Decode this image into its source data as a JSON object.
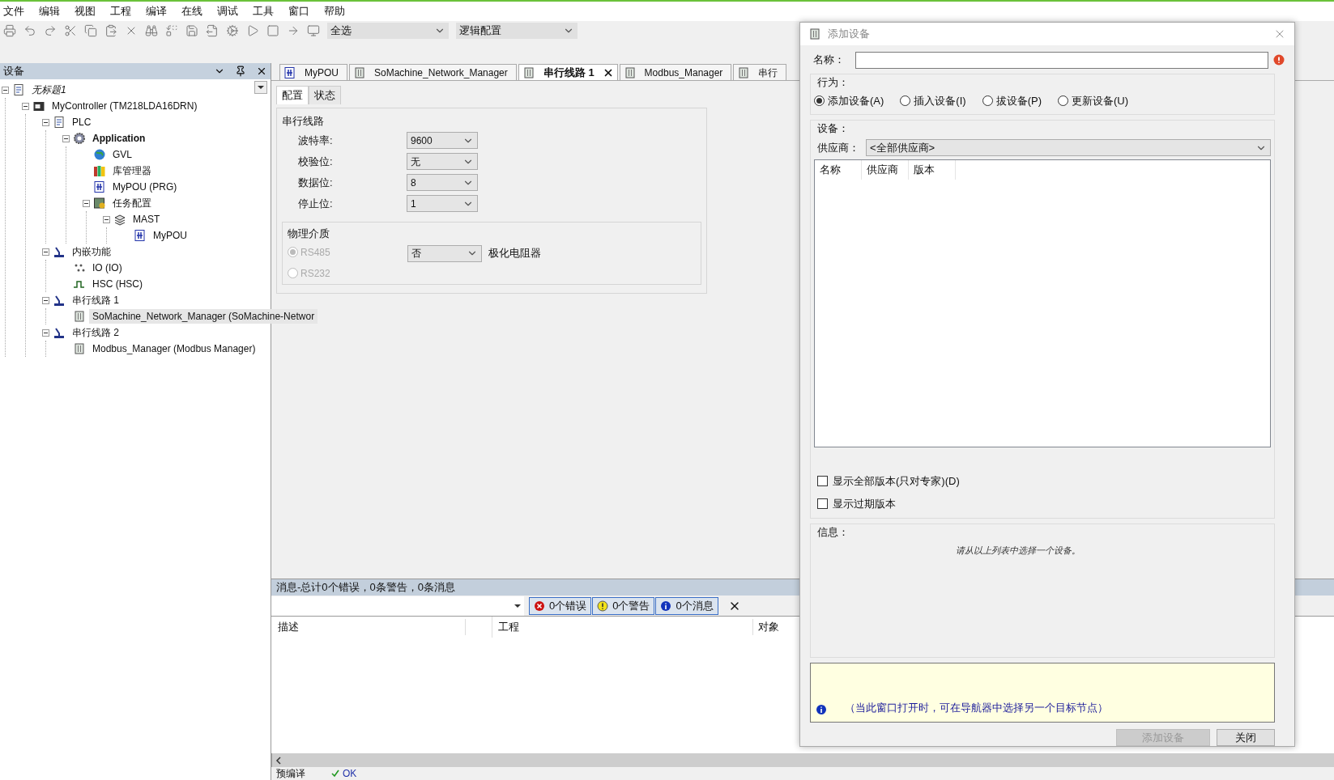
{
  "menu": [
    "文件",
    "编辑",
    "视图",
    "工程",
    "编译",
    "在线",
    "调试",
    "工具",
    "窗口",
    "帮助"
  ],
  "toolbar": {
    "selection": "全选",
    "configuration": "逻辑配置"
  },
  "devices_panel": {
    "title": "设备",
    "tree": [
      {
        "kind": "project",
        "label": "无标题1",
        "expanded": true,
        "selected": false,
        "children": [
          {
            "kind": "controller",
            "label": "MyController (TM218LDA16DRN)",
            "expanded": true,
            "selected": false,
            "children": [
              {
                "kind": "plc",
                "label": "PLC",
                "expanded": true,
                "selected": false,
                "children": [
                  {
                    "kind": "application",
                    "label": "Application",
                    "expanded": true,
                    "selected": false,
                    "children": [
                      {
                        "kind": "gvl",
                        "label": "GVL",
                        "selected": false
                      },
                      {
                        "kind": "library",
                        "label": "库管理器",
                        "selected": false
                      },
                      {
                        "kind": "pou",
                        "label": "MyPOU (PRG)",
                        "selected": false
                      },
                      {
                        "kind": "task_config",
                        "label": "任务配置",
                        "expanded": true,
                        "selected": false,
                        "children": [
                          {
                            "kind": "task",
                            "label": "MAST",
                            "expanded": true,
                            "selected": false,
                            "children": [
                              {
                                "kind": "pou_call",
                                "label": "MyPOU",
                                "selected": false
                              }
                            ]
                          }
                        ]
                      }
                    ]
                  }
                ]
              },
              {
                "kind": "folder",
                "label": "内嵌功能",
                "expanded": true,
                "selected": false,
                "children": [
                  {
                    "kind": "io",
                    "label": "IO (IO)",
                    "selected": false
                  },
                  {
                    "kind": "hsc",
                    "label": "HSC (HSC)",
                    "selected": false
                  }
                ]
              },
              {
                "kind": "folder",
                "label": "串行线路 1",
                "expanded": true,
                "selected": false,
                "children": [
                  {
                    "kind": "manager",
                    "label": "SoMachine_Network_Manager (SoMachine-Networ",
                    "selected": true
                  }
                ]
              },
              {
                "kind": "folder",
                "label": "串行线路 2",
                "expanded": true,
                "selected": false,
                "children": [
                  {
                    "kind": "manager",
                    "label": "Modbus_Manager (Modbus Manager)",
                    "selected": false
                  }
                ]
              }
            ]
          }
        ]
      }
    ]
  },
  "editor_tabs": [
    {
      "kind": "pou",
      "label": "MyPOU",
      "selected": false
    },
    {
      "kind": "manager",
      "label": "SoMachine_Network_Manager",
      "selected": false
    },
    {
      "kind": "manager",
      "label": "串行线路 1",
      "selected": true
    },
    {
      "kind": "manager",
      "label": "Modbus_Manager",
      "selected": false
    },
    {
      "kind": "manager",
      "label": "串行",
      "selected": false
    }
  ],
  "sub_tabs": [
    {
      "label": "配置",
      "selected": true
    },
    {
      "label": "状态",
      "selected": false
    }
  ],
  "serial_line": {
    "title": "串行线路",
    "fields": [
      {
        "label": "波特率:",
        "value": "9600"
      },
      {
        "label": "校验位:",
        "value": "无"
      },
      {
        "label": "数据位:",
        "value": "8"
      },
      {
        "label": "停止位:",
        "value": "1"
      }
    ]
  },
  "physical_medium": {
    "title": "物理介质",
    "options": [
      {
        "label": "RS485",
        "selected": true,
        "disabled": true
      },
      {
        "label": "RS232",
        "selected": false,
        "disabled": true
      }
    ],
    "polarization": {
      "value": "否",
      "label": "极化电阻器"
    }
  },
  "messages": {
    "title": "消息-总计0个错误，0条警告，0条消息",
    "filters": [
      {
        "kind": "error",
        "label": "0个错误"
      },
      {
        "kind": "warning",
        "label": "0个警告"
      },
      {
        "kind": "info",
        "label": "0个消息"
      }
    ],
    "columns": [
      "描述",
      "工程",
      "对象"
    ]
  },
  "status_bar": {
    "label": "预编译",
    "value": "OK"
  },
  "dialog": {
    "title": "添加设备",
    "name_label": "名称：",
    "behavior": {
      "title": "行为：",
      "options": [
        {
          "label": "添加设备(A)",
          "selected": true
        },
        {
          "label": "插入设备(I)",
          "selected": false
        },
        {
          "label": "拔设备(P)",
          "selected": false
        },
        {
          "label": "更新设备(U)",
          "selected": false
        }
      ]
    },
    "device": {
      "title": "设备：",
      "vendor_label": "供应商：",
      "vendor_value": "<全部供应商>",
      "columns": [
        "名称",
        "供应商",
        "版本"
      ]
    },
    "checkboxes": [
      {
        "label": "显示全部版本(只对专家)(D)",
        "checked": false
      },
      {
        "label": "显示过期版本",
        "checked": false
      }
    ],
    "info": {
      "title": "信息：",
      "text": "请从以上列表中选择一个设备。"
    },
    "hint": "（当此窗口打开时，可在导航器中选择另一个目标节点）",
    "buttons": [
      {
        "label": "添加设备",
        "disabled": true
      },
      {
        "label": "关闭",
        "disabled": false
      }
    ]
  }
}
